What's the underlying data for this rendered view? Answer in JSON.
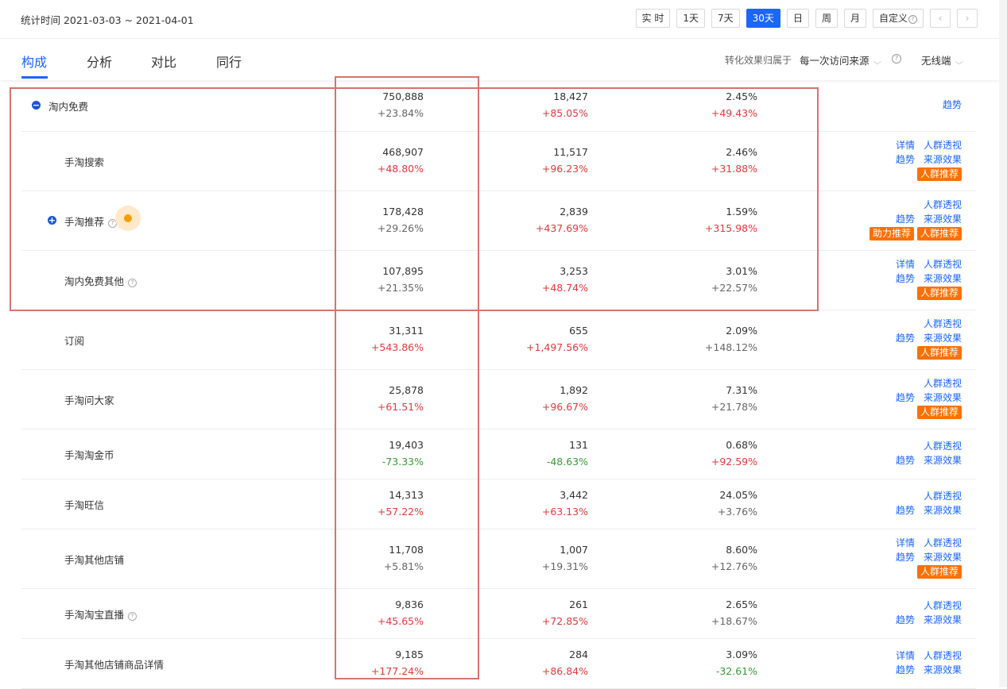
{
  "header": {
    "stat_time_label": "统计时间 2021-03-03 ~ 2021-04-01",
    "range_buttons": [
      "实 时",
      "1天",
      "7天",
      "30天",
      "日",
      "周",
      "月"
    ],
    "active_range": "30天",
    "custom_label": "自定义",
    "prev_symbol": "‹",
    "next_symbol": "›"
  },
  "tabs": [
    "构成",
    "分析",
    "对比",
    "同行"
  ],
  "active_tab": "构成",
  "filters": {
    "attribution_label": "转化效果归属于",
    "attribution_value": "每一次访问来源",
    "device_value": "无线端"
  },
  "colors": {
    "accent": "#1a66ff",
    "up": "#e4393c",
    "down": "#3a9a3a",
    "badge": "#ff7000",
    "highlight": "#d9736f"
  },
  "rows": [
    {
      "name": "淘内免费",
      "level": 0,
      "toggle": "−",
      "help": false,
      "m1": "750,888",
      "m1c": "+23.84%",
      "m2": "18,427",
      "m2c": "+85.05%",
      "m3": "2.45%",
      "m3c": "+49.43%",
      "links1": [],
      "links2": [
        "趋势"
      ],
      "badges": []
    },
    {
      "name": "手淘搜索",
      "level": 1,
      "toggle": "",
      "help": false,
      "m1": "468,907",
      "m1c": "+48.80%",
      "m2": "11,517",
      "m2c": "+96.23%",
      "m3": "2.46%",
      "m3c": "+31.88%",
      "links1": [
        "详情",
        "人群透视"
      ],
      "links2": [
        "趋势",
        "来源效果"
      ],
      "badges": [
        "人群推荐"
      ]
    },
    {
      "name": "手淘推荐",
      "level": 1,
      "toggle": "+",
      "help": true,
      "m1": "178,428",
      "m1c": "+29.26%",
      "m2": "2,839",
      "m2c": "+437.69%",
      "m3": "1.59%",
      "m3c": "+315.98%",
      "links1": [
        "人群透视"
      ],
      "links2": [
        "趋势",
        "来源效果"
      ],
      "badges": [
        "助力推荐",
        "人群推荐"
      ]
    },
    {
      "name": "淘内免费其他",
      "level": 1,
      "toggle": "",
      "help": true,
      "m1": "107,895",
      "m1c": "+21.35%",
      "m2": "3,253",
      "m2c": "+48.74%",
      "m3": "3.01%",
      "m3c": "+22.57%",
      "links1": [
        "详情",
        "人群透视"
      ],
      "links2": [
        "趋势",
        "来源效果"
      ],
      "badges": [
        "人群推荐"
      ]
    },
    {
      "name": "订阅",
      "level": 1,
      "toggle": "",
      "help": false,
      "m1": "31,311",
      "m1c": "+543.86%",
      "m2": "655",
      "m2c": "+1,497.56%",
      "m3": "2.09%",
      "m3c": "+148.12%",
      "links1": [
        "人群透视"
      ],
      "links2": [
        "趋势",
        "来源效果"
      ],
      "badges": [
        "人群推荐"
      ]
    },
    {
      "name": "手淘问大家",
      "level": 1,
      "toggle": "",
      "help": false,
      "m1": "25,878",
      "m1c": "+61.51%",
      "m2": "1,892",
      "m2c": "+96.67%",
      "m3": "7.31%",
      "m3c": "+21.78%",
      "links1": [
        "人群透视"
      ],
      "links2": [
        "趋势",
        "来源效果"
      ],
      "badges": [
        "人群推荐"
      ]
    },
    {
      "name": "手淘淘金币",
      "level": 1,
      "toggle": "",
      "help": false,
      "m1": "19,403",
      "m1c": "-73.33%",
      "m2": "131",
      "m2c": "-48.63%",
      "m3": "0.68%",
      "m3c": "+92.59%",
      "links1": [
        "人群透视"
      ],
      "links2": [
        "趋势",
        "来源效果"
      ],
      "badges": []
    },
    {
      "name": "手淘旺信",
      "level": 1,
      "toggle": "",
      "help": false,
      "m1": "14,313",
      "m1c": "+57.22%",
      "m2": "3,442",
      "m2c": "+63.13%",
      "m3": "24.05%",
      "m3c": "+3.76%",
      "links1": [
        "人群透视"
      ],
      "links2": [
        "趋势",
        "来源效果"
      ],
      "badges": []
    },
    {
      "name": "手淘其他店铺",
      "level": 1,
      "toggle": "",
      "help": false,
      "m1": "11,708",
      "m1c": "+5.81%",
      "m2": "1,007",
      "m2c": "+19.31%",
      "m3": "8.60%",
      "m3c": "+12.76%",
      "links1": [
        "详情",
        "人群透视"
      ],
      "links2": [
        "趋势",
        "来源效果"
      ],
      "badges": [
        "人群推荐"
      ]
    },
    {
      "name": "手淘淘宝直播",
      "level": 1,
      "toggle": "",
      "help": true,
      "m1": "9,836",
      "m1c": "+45.65%",
      "m2": "261",
      "m2c": "+72.85%",
      "m3": "2.65%",
      "m3c": "+18.67%",
      "links1": [
        "人群透视"
      ],
      "links2": [
        "趋势",
        "来源效果"
      ],
      "badges": []
    },
    {
      "name": "手淘其他店铺商品详情",
      "level": 1,
      "toggle": "",
      "help": false,
      "m1": "9,185",
      "m1c": "+177.24%",
      "m2": "284",
      "m2c": "+86.84%",
      "m3": "3.09%",
      "m3c": "-32.61%",
      "links1": [
        "详情",
        "人群透视"
      ],
      "links2": [
        "趋势",
        "来源效果"
      ],
      "badges": []
    }
  ]
}
